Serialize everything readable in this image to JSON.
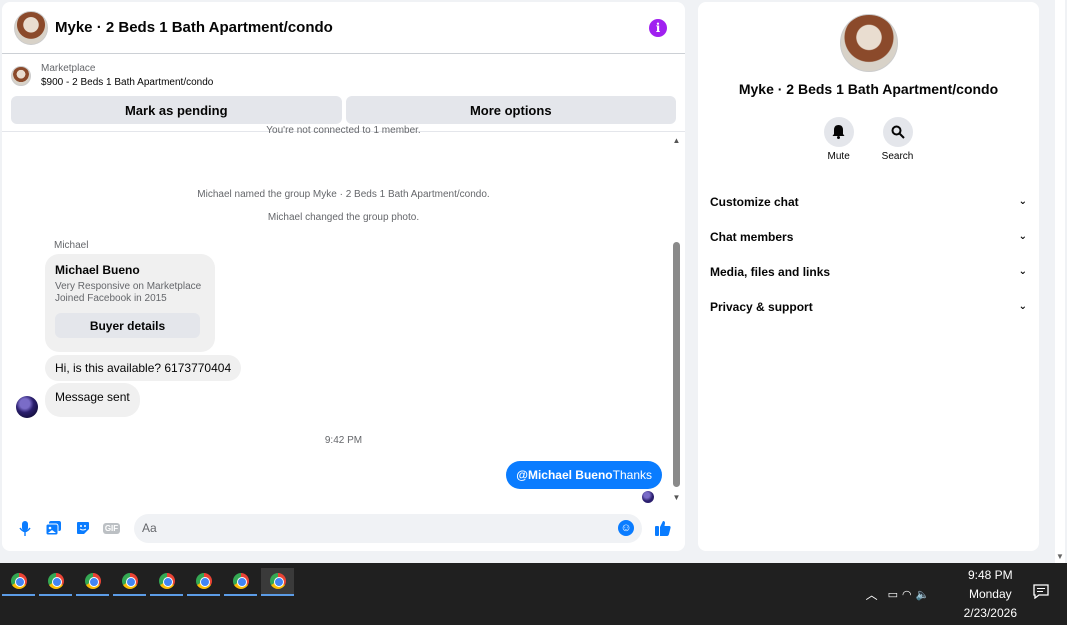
{
  "chat": {
    "title": "Myke · 2 Beds 1 Bath Apartment/condo",
    "listing_source": "Marketplace",
    "listing_text": "$900 - 2 Beds 1 Bath Apartment/condo",
    "btn_pending": "Mark as pending",
    "btn_more": "More options",
    "cut_text": "You're not connected to 1 member.",
    "sys1": "Michael named the group Myke · 2 Beds 1 Bath Apartment/condo.",
    "sys2": "Michael changed the group photo.",
    "sender": "Michael",
    "card_name": "Michael Bueno",
    "card_line1": "Very Responsive on Marketplace",
    "card_line2": "Joined Facebook in 2015",
    "card_btn": "Buyer details",
    "msg1": "Hi, is this available? 6173770404",
    "msg2": "Message sent",
    "time": "9:42 PM",
    "out_mention": "@Michael Bueno",
    "out_text": "Thanks",
    "composer_placeholder": "Aa",
    "gif_label": "GIF"
  },
  "side": {
    "title": "Myke · 2 Beds 1 Bath Apartment/condo",
    "mute": "Mute",
    "search": "Search",
    "sections": [
      "Customize chat",
      "Chat members",
      "Media, files and links",
      "Privacy & support"
    ]
  },
  "taskbar": {
    "time": "9:48 PM",
    "day": "Monday",
    "date": "2/23/2026",
    "app_count": 8
  },
  "colors": {
    "accent": "#0a7cff",
    "info": "#a020f0"
  }
}
